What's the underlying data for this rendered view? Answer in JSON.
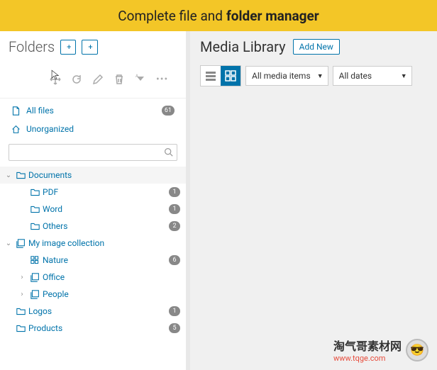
{
  "banner": {
    "text1": "Complete file and",
    "text2": "folder manager"
  },
  "sidebar": {
    "title": "Folders",
    "btn_folder": "+",
    "btn_gallery": "+",
    "quick": [
      {
        "label": "All files",
        "count": "61"
      },
      {
        "label": "Unorganized",
        "count": ""
      }
    ],
    "search_placeholder": ""
  },
  "tree": [
    {
      "label": "Documents",
      "level": 0,
      "caret": "⌄",
      "icon": "folder",
      "count": "",
      "root": true
    },
    {
      "label": "PDF",
      "level": 1,
      "caret": "",
      "icon": "folder",
      "count": "1"
    },
    {
      "label": "Word",
      "level": 1,
      "caret": "",
      "icon": "folder",
      "count": "1"
    },
    {
      "label": "Others",
      "level": 1,
      "caret": "",
      "icon": "folder",
      "count": "2"
    },
    {
      "label": "My image collection",
      "level": 0,
      "caret": "⌄",
      "icon": "gallery",
      "count": ""
    },
    {
      "label": "Nature",
      "level": 1,
      "caret": "",
      "icon": "grid",
      "count": "6"
    },
    {
      "label": "Office",
      "level": 1,
      "caret": "›",
      "icon": "gallery",
      "count": ""
    },
    {
      "label": "People",
      "level": 1,
      "caret": "›",
      "icon": "gallery",
      "count": ""
    },
    {
      "label": "Logos",
      "level": 0,
      "caret": "",
      "icon": "folder",
      "count": "1"
    },
    {
      "label": "Products",
      "level": 0,
      "caret": "",
      "icon": "folder",
      "count": "5"
    }
  ],
  "content": {
    "title": "Media Library",
    "add_new": "Add New",
    "filter_type": "All media items",
    "filter_date": "All dates"
  },
  "watermark": {
    "text": "淘气哥素材网",
    "sub": "www.tqge.com"
  }
}
